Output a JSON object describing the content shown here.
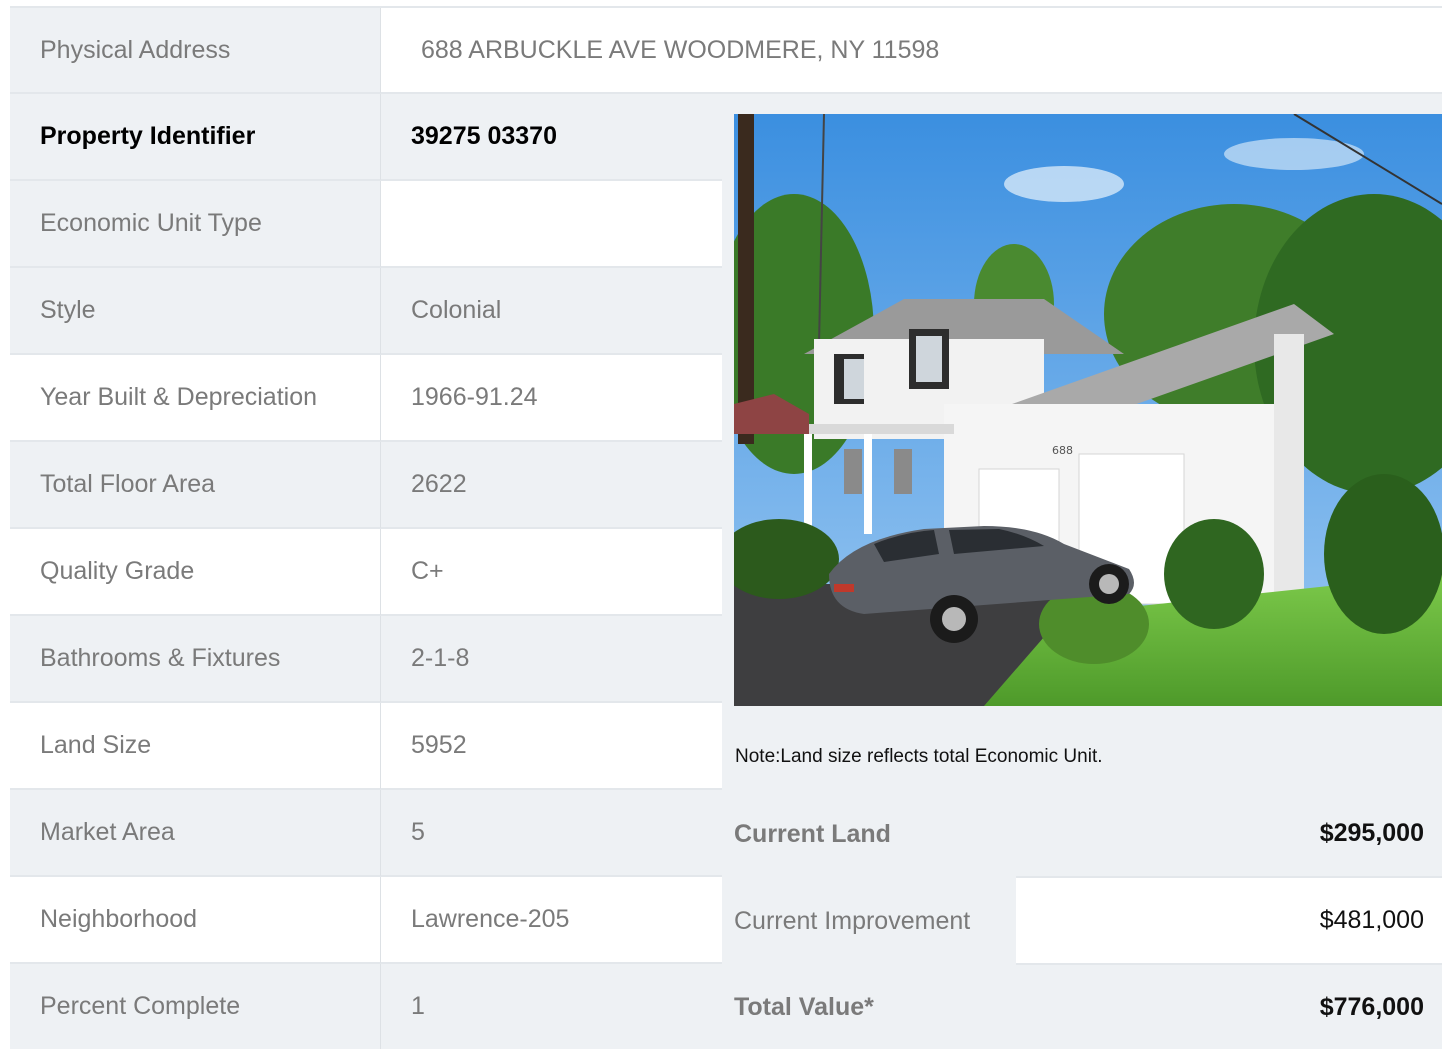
{
  "address": {
    "label": "Physical Address",
    "value": "688  ARBUCKLE AVE  WOODMERE, NY  11598"
  },
  "rows": [
    {
      "label": "Property Identifier",
      "value": "39275  03370"
    },
    {
      "label": "Economic Unit Type",
      "value": ""
    },
    {
      "label": "Style",
      "value": "Colonial"
    },
    {
      "label": "Year Built & Depreciation",
      "value": "1966-91.24"
    },
    {
      "label": "Total Floor Area",
      "value": "2622"
    },
    {
      "label": "Quality Grade",
      "value": "C+"
    },
    {
      "label": "Bathrooms & Fixtures",
      "value": "2-1-8"
    },
    {
      "label": "Land Size",
      "value": "5952"
    },
    {
      "label": "Market Area",
      "value": "5"
    },
    {
      "label": "Neighborhood",
      "value": "Lawrence-205"
    },
    {
      "label": "Percent Complete",
      "value": "1"
    }
  ],
  "note": "Note:Land size reflects total Economic Unit.",
  "values": [
    {
      "label": "Current Land",
      "amount": "$295,000"
    },
    {
      "label": "Current Improvement",
      "amount": "$481,000"
    },
    {
      "label": "Total Value*",
      "amount": "$776,000"
    }
  ],
  "photo": {
    "house_number": "688"
  },
  "colors": {
    "shade": "#eef1f4",
    "border": "#e3e7eb",
    "label_text": "#7a7a7a"
  }
}
